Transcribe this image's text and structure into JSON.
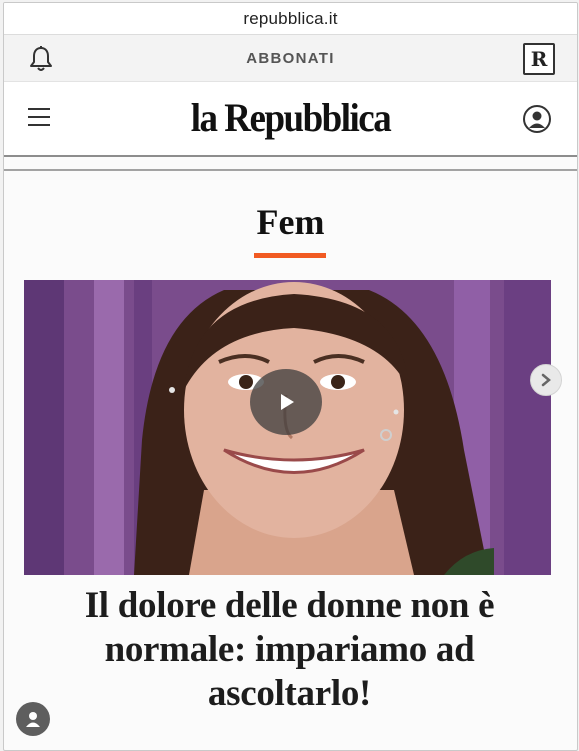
{
  "browser": {
    "url": "repubblica.it"
  },
  "topbar": {
    "subscribe_label": "ABBONATI",
    "badge_letter": "R"
  },
  "header": {
    "logo_text": "la Repubblica"
  },
  "section": {
    "title": "Fem",
    "accent_color": "#f15a22"
  },
  "article": {
    "headline": "Il dolore delle donne non è normale: impariamo ad ascoltarlo!",
    "media_type": "video"
  },
  "icons": {
    "bell": "bell-icon",
    "menu": "hamburger-menu-icon",
    "account": "user-account-icon",
    "play": "play-icon",
    "next": "chevron-right-icon",
    "floating": "user-icon"
  }
}
